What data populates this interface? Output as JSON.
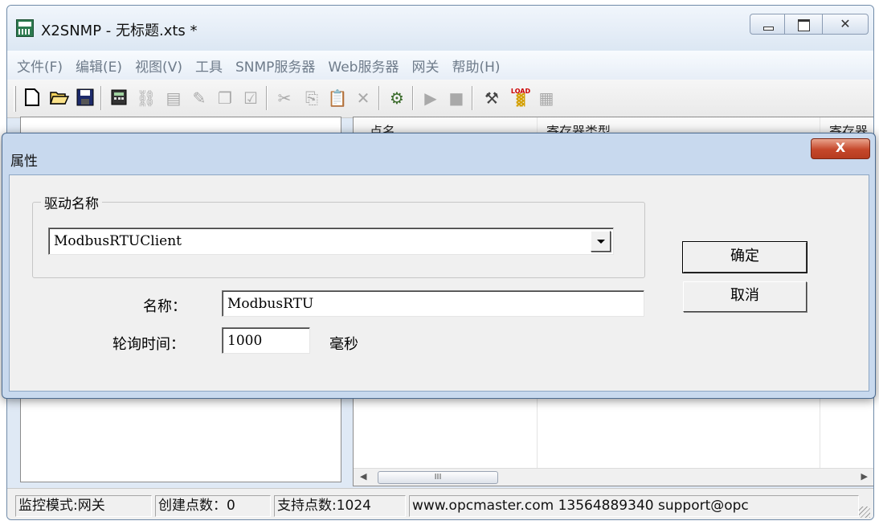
{
  "window": {
    "title": "X2SNMP - 无标题.xts *",
    "close_glyph": "✕"
  },
  "menu": [
    "文件(F)",
    "编辑(E)",
    "视图(V)",
    "工具",
    "SNMP服务器",
    "Web服务器",
    "网关",
    "帮助(H)"
  ],
  "toolbar": {
    "load_label": "LOAD"
  },
  "list": {
    "columns": [
      "点名",
      "寄存器类型",
      "寄存器"
    ],
    "scroll_thumb": "III"
  },
  "dialog": {
    "title": "属性",
    "close_glyph": "X",
    "group_label": "驱动名称",
    "driver_value": "ModbusRTUClient",
    "name_label": "名称：",
    "name_value": "ModbusRTU",
    "poll_label": "轮询时间：",
    "poll_value": "1000",
    "poll_unit": "毫秒",
    "ok_label": "确定",
    "cancel_label": "取消"
  },
  "status": {
    "mode": "监控模式:网关",
    "created_points": "创建点数：0",
    "supported_points": "支持点数:1024",
    "contact": "www.opcmaster.com 13564889340 support@opc"
  }
}
